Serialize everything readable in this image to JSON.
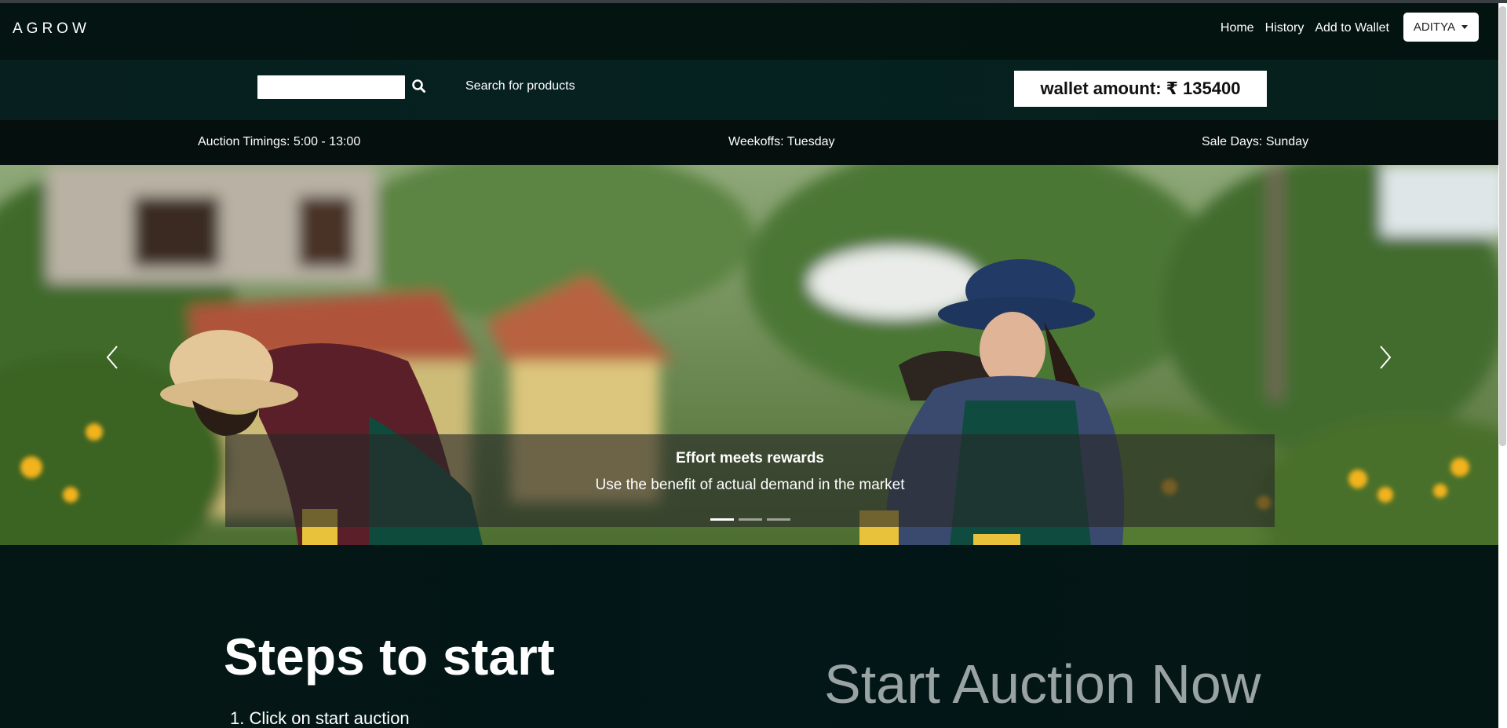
{
  "navbar": {
    "brand": "AGROW",
    "links": [
      "Home",
      "History",
      "Add to Wallet"
    ],
    "user": "ADITYA"
  },
  "search": {
    "placeholder": "",
    "label": "Search for products"
  },
  "wallet": {
    "text": "wallet amount: ₹ 135400"
  },
  "info": {
    "auction_timings": "Auction Timings: 5:00 - 13:00",
    "weekoffs": "Weekoffs: Tuesday",
    "sale_days": "Sale Days: Sunday"
  },
  "carousel": {
    "caption_title": "Effort meets rewards",
    "caption_text": "Use the benefit of actual demand in the market",
    "slide_count": 3,
    "active_slide": 1
  },
  "steps": {
    "title": "Steps to start",
    "items": [
      "1. Click on start auction"
    ]
  },
  "cta": {
    "start_auction": "Start Auction Now"
  },
  "colors": {
    "navbar_bg": "#041412",
    "searchbar_bg": "#052120",
    "infobar_bg": "#050f0d",
    "cta_text": "#9aa3a3"
  }
}
